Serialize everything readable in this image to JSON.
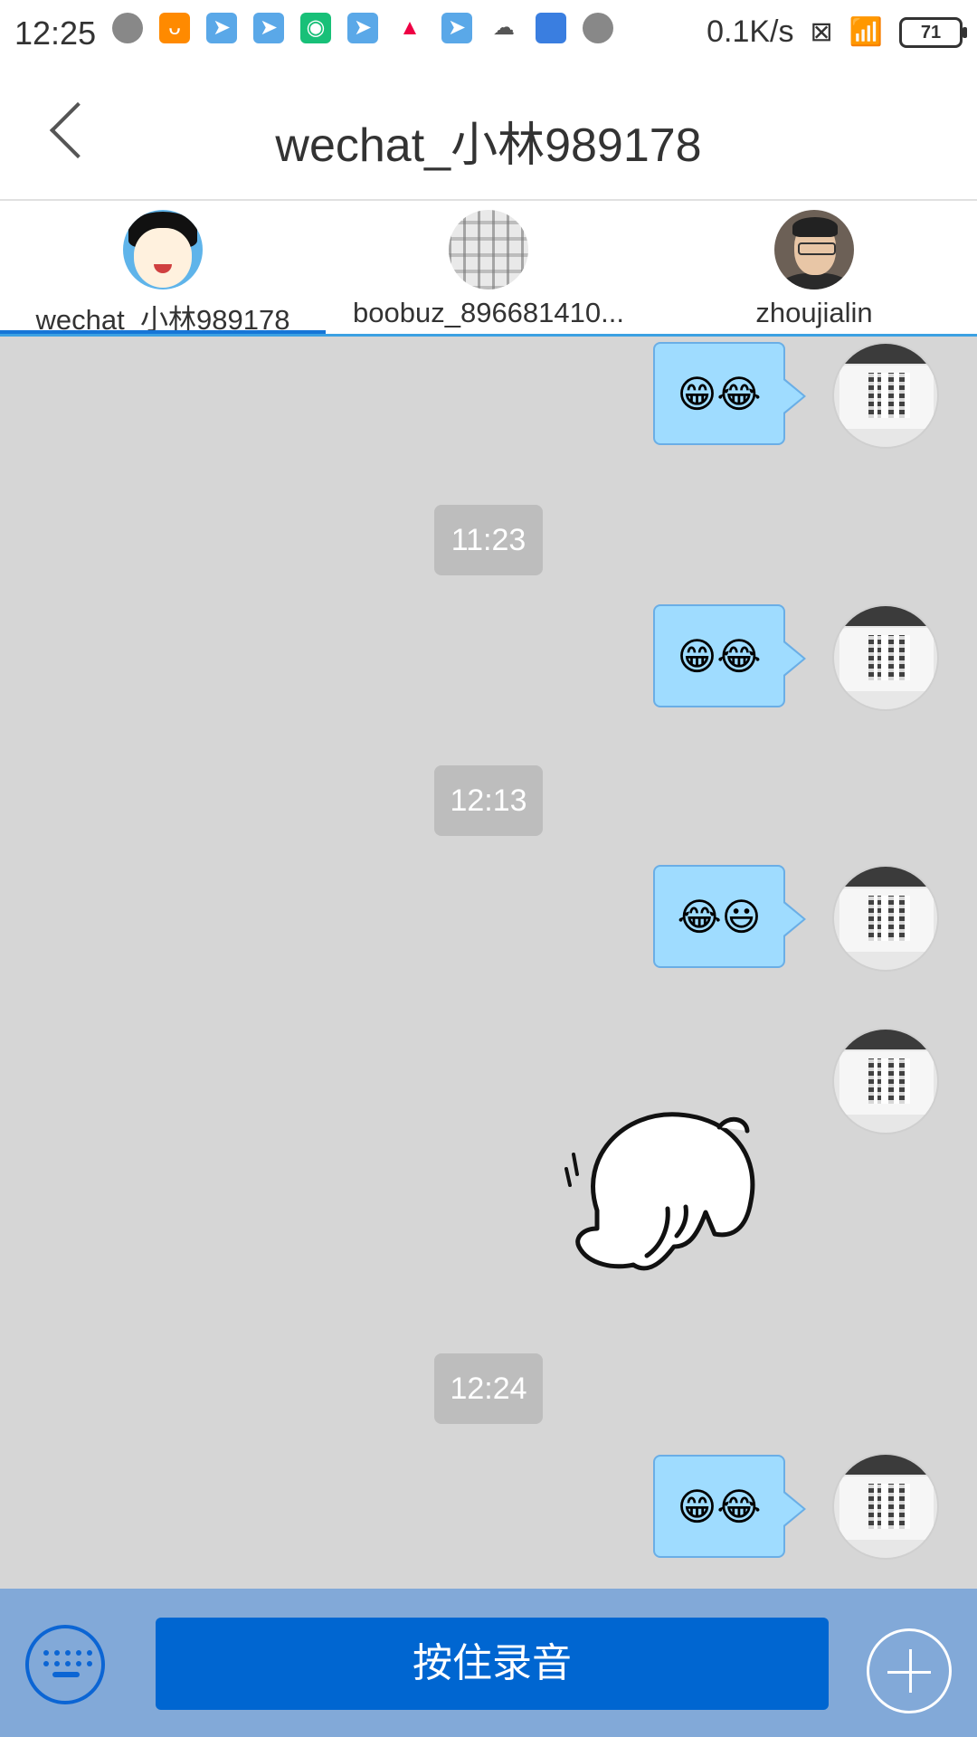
{
  "status_bar": {
    "time": "12:25",
    "network_speed": "0.1K/s",
    "battery": "71",
    "notification_icons": [
      "record-icon",
      "taobao-icon",
      "send-icon",
      "send-icon",
      "app-icon",
      "send-icon",
      "photos-icon",
      "send-icon",
      "cloud-icon",
      "landscape-icon",
      "record-icon"
    ]
  },
  "header": {
    "title": "wechat_小林989178",
    "back_icon": "chevron-left-icon"
  },
  "tabs": [
    {
      "label": "wechat_小林989178",
      "active": true
    },
    {
      "label": "boobuz_896681410...",
      "active": false
    },
    {
      "label": "zhoujialin",
      "active": false
    }
  ],
  "messages": [
    {
      "type": "emoji",
      "content": "😁😂"
    },
    {
      "type": "time",
      "content": "11:23"
    },
    {
      "type": "emoji",
      "content": "😁😂"
    },
    {
      "type": "time",
      "content": "12:13"
    },
    {
      "type": "emoji",
      "content": "😂😃"
    },
    {
      "type": "sticker",
      "content": "bunny-sticker"
    },
    {
      "type": "time",
      "content": "12:24"
    },
    {
      "type": "emoji",
      "content": "😁😂"
    }
  ],
  "bottom_bar": {
    "record_label": "按住录音",
    "keyboard_icon": "keyboard-icon",
    "plus_icon": "plus-icon"
  },
  "colors": {
    "bubble": "#9fdcff",
    "tab_indicator": "#1676d7",
    "record_button": "#0066d1",
    "bottom_bar": "#82a9d8"
  }
}
